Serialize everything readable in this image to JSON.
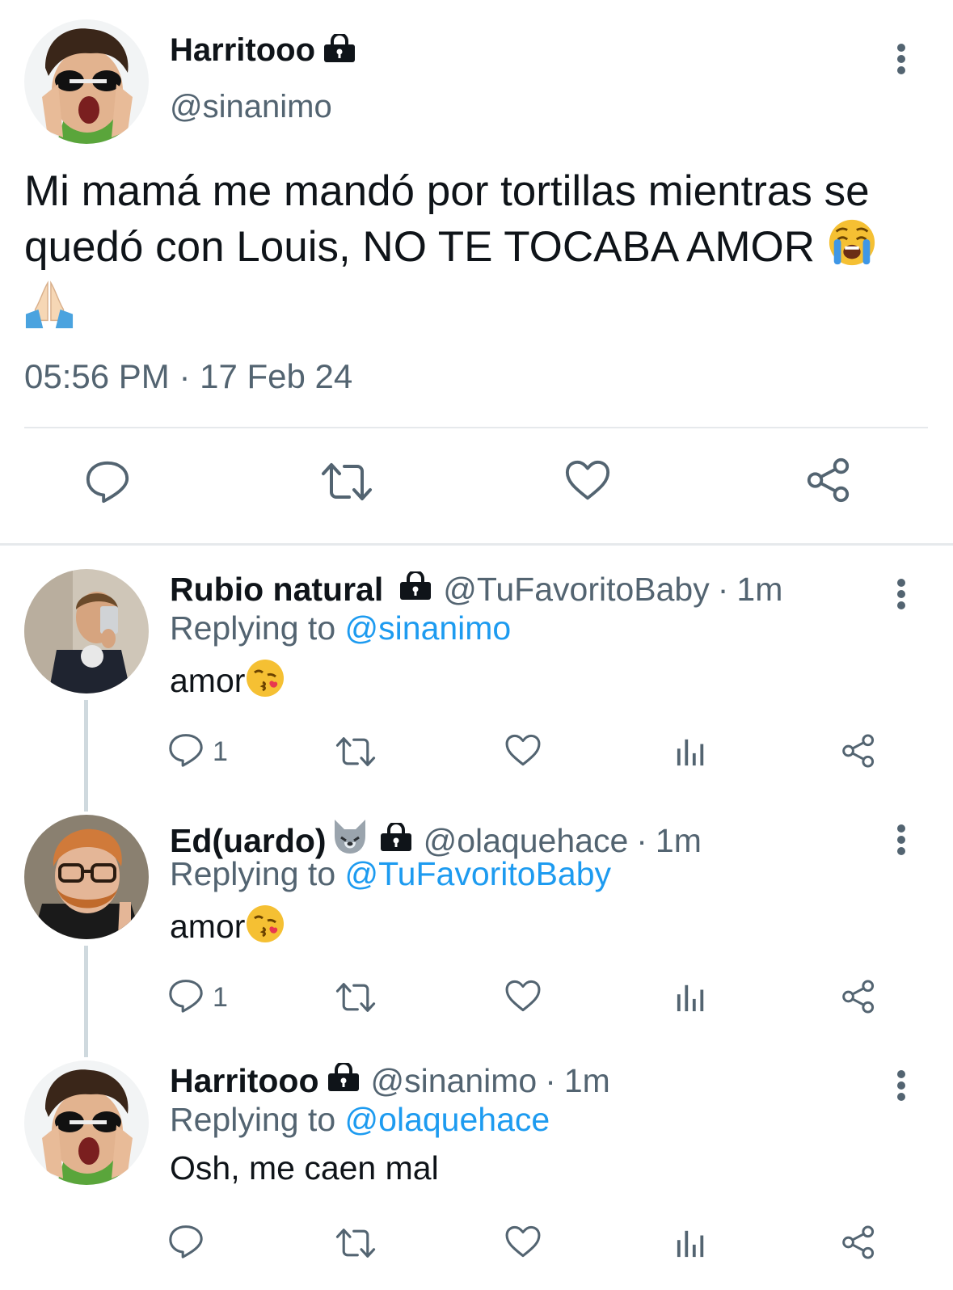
{
  "main_tweet": {
    "display_name": "Harritooo",
    "handle": "@sinanimo",
    "text": "Mi mamá me mandó por tortillas mientras se quedó con Louis, NO TE TOCABA AMOR",
    "emojis": [
      "loudly-crying-face",
      "folded-hands"
    ],
    "timestamp": "05:56 PM · 17 Feb 24",
    "actions": [
      "reply",
      "retweet",
      "like",
      "share"
    ]
  },
  "replies": [
    {
      "display_name": "Rubio natural",
      "handle": "@TuFavoritoBaby",
      "time_sep": "·",
      "time": "1m",
      "replying_prefix": "Replying to",
      "replying_to": "@sinanimo",
      "text": "amor",
      "emoji": "kissing-face",
      "reply_count": "1"
    },
    {
      "display_name": "Ed(uardo)",
      "name_emoji": "wolf-face",
      "handle": "@olaquehace",
      "time_sep": "·",
      "time": "1m",
      "replying_prefix": "Replying to",
      "replying_to": "@TuFavoritoBaby",
      "text": "amor",
      "emoji": "kissing-face",
      "reply_count": "1"
    },
    {
      "display_name": "Harritooo",
      "handle": "@sinanimo",
      "time_sep": "·",
      "time": "1m",
      "replying_prefix": "Replying to",
      "replying_to": "@olaquehace",
      "text": "Osh, me caen mal",
      "reply_count": ""
    }
  ],
  "colors": {
    "text": "#0f1419",
    "secondary": "#536471",
    "link": "#1d9bf0",
    "divider": "#e6e9ec"
  }
}
